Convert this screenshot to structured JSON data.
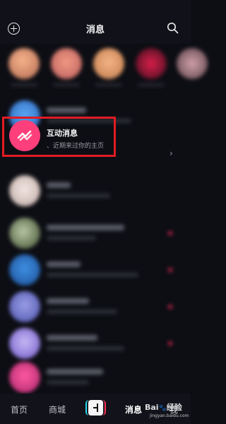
{
  "header": {
    "title": "消息",
    "add_icon": "plus-circle-icon",
    "search_icon": "search-icon"
  },
  "interaction_row": {
    "title": "互动消息",
    "subtitle": "、近期来过你的主页",
    "icon": "interaction-wave-icon",
    "accent_color": "#ff3f7b",
    "chevron": "›"
  },
  "highlight": {
    "color": "#e31b23"
  },
  "bottom_nav": {
    "home": "首页",
    "mall": "商城",
    "publish_icon": "plus-icon",
    "messages": "消息",
    "me": "我"
  },
  "watermark": {
    "logo_text_1": "Bai",
    "logo_text_2": "经验",
    "url": "jingyan.baidu.com"
  }
}
